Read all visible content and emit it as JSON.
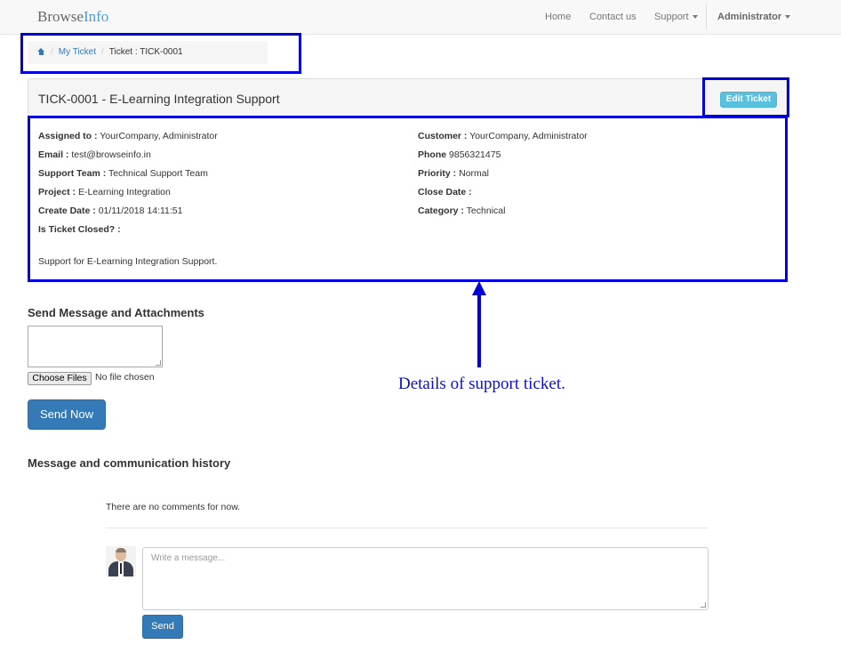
{
  "brand": {
    "part1": "Browse",
    "part2": "Info"
  },
  "nav": {
    "home": "Home",
    "contact": "Contact us",
    "support": "Support",
    "user": "Administrator"
  },
  "breadcrumb": {
    "parent": "My Ticket",
    "current": "Ticket : TICK-0001"
  },
  "ticket": {
    "title": "TICK-0001 - E-Learning Integration Support",
    "edit_label": "Edit Ticket",
    "left_fields": [
      {
        "label": "Assigned to :",
        "value": "YourCompany, Administrator"
      },
      {
        "label": "Email :",
        "value": "test@browseinfo.in"
      },
      {
        "label": "Support Team :",
        "value": "Technical Support Team"
      },
      {
        "label": "Project :",
        "value": "E-Learning Integration"
      },
      {
        "label": "Create Date :",
        "value": "01/11/2018 14:11:51"
      },
      {
        "label": "Is Ticket Closed? :",
        "value": ""
      }
    ],
    "right_fields": [
      {
        "label": "Customer :",
        "value": "YourCompany, Administrator"
      },
      {
        "label": "Phone",
        "value": "9856321475"
      },
      {
        "label": "Priority :",
        "value": "Normal"
      },
      {
        "label": "Close Date :",
        "value": ""
      },
      {
        "label": "Category :",
        "value": "Technical"
      }
    ],
    "description": "Support for E-Learning Integration Support."
  },
  "send_section": {
    "title": "Send Message and Attachments",
    "choose_files_label": "Choose Files",
    "file_status": "No file chosen",
    "send_label": "Send Now"
  },
  "history": {
    "title": "Message and communication history",
    "empty_text": "There are no comments for now.",
    "input_placeholder": "Write a message...",
    "send_label": "Send"
  },
  "annotation": {
    "text": "Details of support ticket."
  },
  "colors": {
    "highlight": "#0000d8",
    "primary": "#337ab7",
    "info": "#5bc0de",
    "annotation_text": "#1010c8"
  }
}
